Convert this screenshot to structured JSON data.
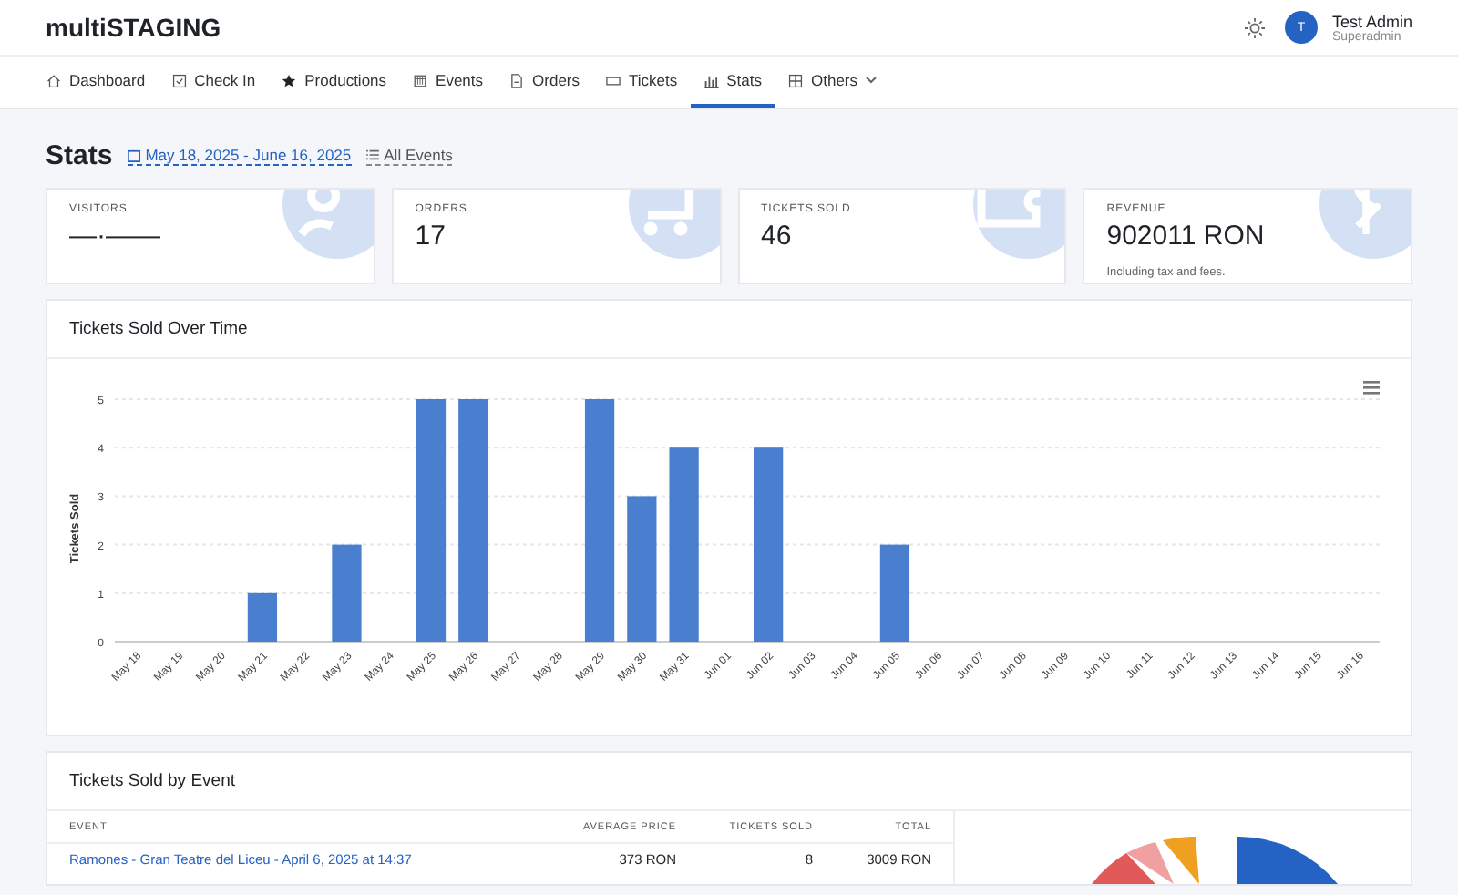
{
  "app": {
    "title": "multiSTAGING"
  },
  "user": {
    "initial": "T",
    "name": "Test Admin",
    "role": "Superadmin"
  },
  "nav": [
    {
      "label": "Dashboard",
      "selected": false
    },
    {
      "label": "Check In",
      "selected": false
    },
    {
      "label": "Productions",
      "selected": false
    },
    {
      "label": "Events",
      "selected": false
    },
    {
      "label": "Orders",
      "selected": false
    },
    {
      "label": "Tickets",
      "selected": false
    },
    {
      "label": "Stats",
      "selected": true
    },
    {
      "label": "Others",
      "selected": false
    }
  ],
  "page": {
    "title": "Stats",
    "date_range": "May 18, 2025 - June 16, 2025",
    "filter": "All Events"
  },
  "stat_cards": [
    {
      "label": "VISITORS",
      "value": "—·——"
    },
    {
      "label": "ORDERS",
      "value": "17"
    },
    {
      "label": "TICKETS SOLD",
      "value": "46"
    },
    {
      "label": "REVENUE",
      "value": "902011 RON",
      "note": "Including tax and fees."
    }
  ],
  "chart_card": {
    "title": "Tickets Sold Over Time",
    "chart_data": {
      "type": "bar",
      "ylabel": "Tickets Sold",
      "categories": [
        "May 18",
        "May 19",
        "May 20",
        "May 21",
        "May 22",
        "May 23",
        "May 24",
        "May 25",
        "May 26",
        "May 27",
        "May 28",
        "May 29",
        "May 30",
        "May 31",
        "Jun 01",
        "Jun 02",
        "Jun 03",
        "Jun 04",
        "Jun 05",
        "Jun 06",
        "Jun 07",
        "Jun 08",
        "Jun 09",
        "Jun 10",
        "Jun 11",
        "Jun 12",
        "Jun 13",
        "Jun 14",
        "Jun 15",
        "Jun 16"
      ],
      "values": [
        0,
        0,
        0,
        1,
        0,
        2,
        0,
        5,
        5,
        0,
        0,
        5,
        3,
        4,
        0,
        4,
        0,
        0,
        2,
        0,
        0,
        0,
        0,
        0,
        0,
        0,
        0,
        0,
        0,
        0
      ],
      "ylim": [
        0,
        5
      ],
      "yticks": [
        0,
        1,
        2,
        3,
        4,
        5
      ],
      "grid": true
    }
  },
  "event_card": {
    "title": "Tickets Sold by Event",
    "columns": [
      "EVENT",
      "AVERAGE PRICE",
      "TICKETS SOLD",
      "TOTAL"
    ],
    "rows": [
      {
        "event": "Ramones - Gran Teatre del Liceu - April 6, 2025 at 14:37",
        "average_price": "373 RON",
        "tickets_sold": "8",
        "total": "3009 RON"
      }
    ]
  }
}
